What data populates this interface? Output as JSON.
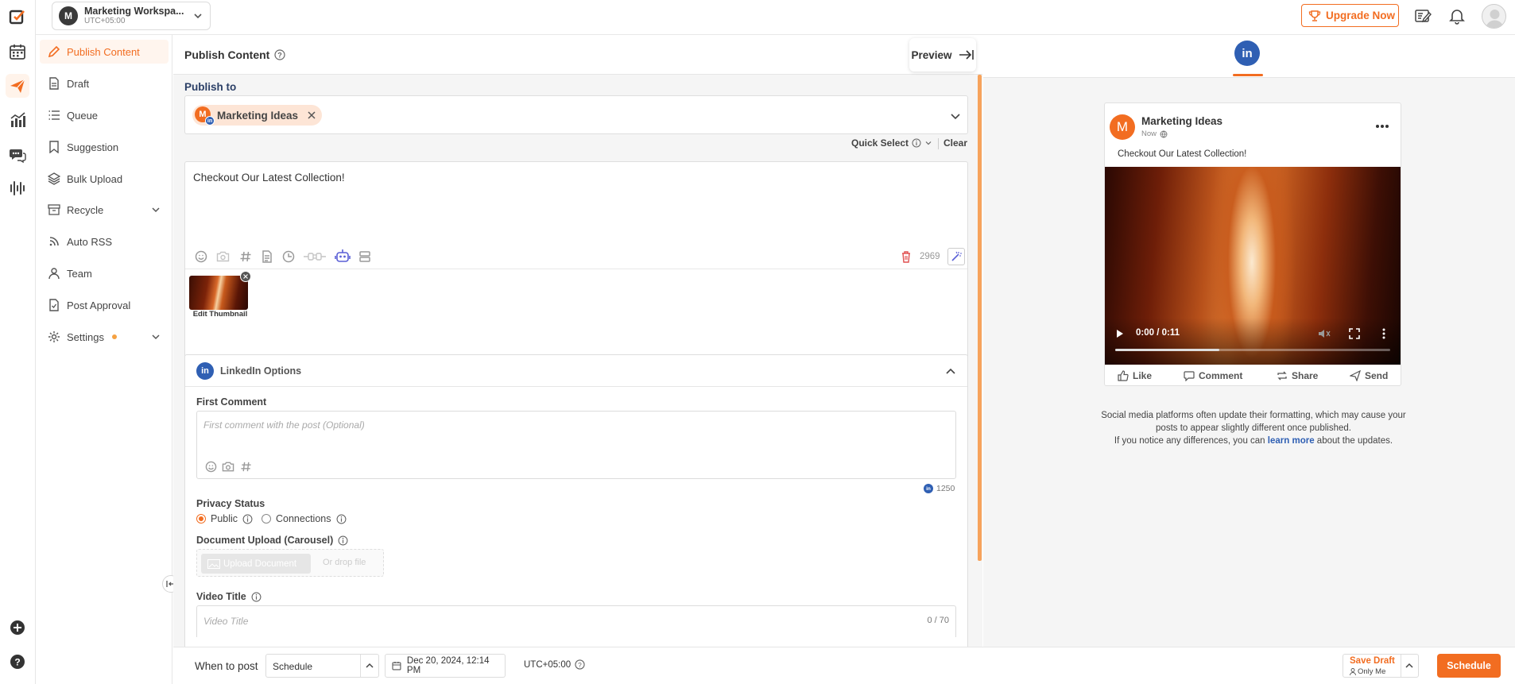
{
  "workspace": {
    "initial": "M",
    "name": "Marketing Workspa...",
    "timezone": "UTC+05:00"
  },
  "topbar": {
    "upgrade_label": "Upgrade Now"
  },
  "sidebar": {
    "items": [
      {
        "label": "Publish Content"
      },
      {
        "label": "Draft"
      },
      {
        "label": "Queue"
      },
      {
        "label": "Suggestion"
      },
      {
        "label": "Bulk Upload"
      },
      {
        "label": "Recycle"
      },
      {
        "label": "Auto RSS"
      },
      {
        "label": "Team"
      },
      {
        "label": "Post Approval"
      },
      {
        "label": "Settings"
      }
    ]
  },
  "editor": {
    "title": "Publish Content",
    "preview_label": "Preview",
    "publish_to_label": "Publish to",
    "selected_account": "Marketing Ideas",
    "quick_select_label": "Quick Select",
    "clear_label": "Clear",
    "post_text": "Checkout Our Latest Collection!",
    "char_count": "2969",
    "edit_thumbnail_label": "Edit Thumbnail"
  },
  "linkedin_options": {
    "title": "LinkedIn Options",
    "first_comment_label": "First Comment",
    "first_comment_placeholder": "First comment with the post (Optional)",
    "comment_char_count": "1250",
    "privacy_label": "Privacy Status",
    "privacy_options": [
      "Public",
      "Connections"
    ],
    "privacy_selected": "Public",
    "doc_upload_label": "Document Upload (Carousel)",
    "upload_doc_button": "Upload Document",
    "drop_file_text": "Or drop file",
    "video_title_label": "Video Title",
    "video_title_placeholder": "Video Title",
    "video_title_count": "0 / 70"
  },
  "preview": {
    "account_initial": "M",
    "account_name": "Marketing Ideas",
    "time": "Now",
    "post_text": "Checkout Our Latest Collection!",
    "video_time": "0:00 / 0:11",
    "video_progress": 0.38,
    "actions": [
      "Like",
      "Comment",
      "Share",
      "Send"
    ],
    "notice_line1": "Social media platforms often update their formatting, which may cause your",
    "notice_line2": "posts to appear slightly different once published.",
    "notice_line3_pre": "If you notice any differences, you can",
    "notice_link": "learn more",
    "notice_line3_post": "about the updates."
  },
  "bottom_bar": {
    "when_label": "When to post",
    "mode": "Schedule",
    "datetime": "Dec 20, 2024, 12:14 PM",
    "timezone": "UTC+05:00",
    "save_draft_label": "Save Draft",
    "save_draft_scope": "Only Me",
    "schedule_button": "Schedule"
  },
  "colors": {
    "accent": "#f26d21",
    "linkedin": "#2f5fb3",
    "link": "#2f5fb3"
  }
}
